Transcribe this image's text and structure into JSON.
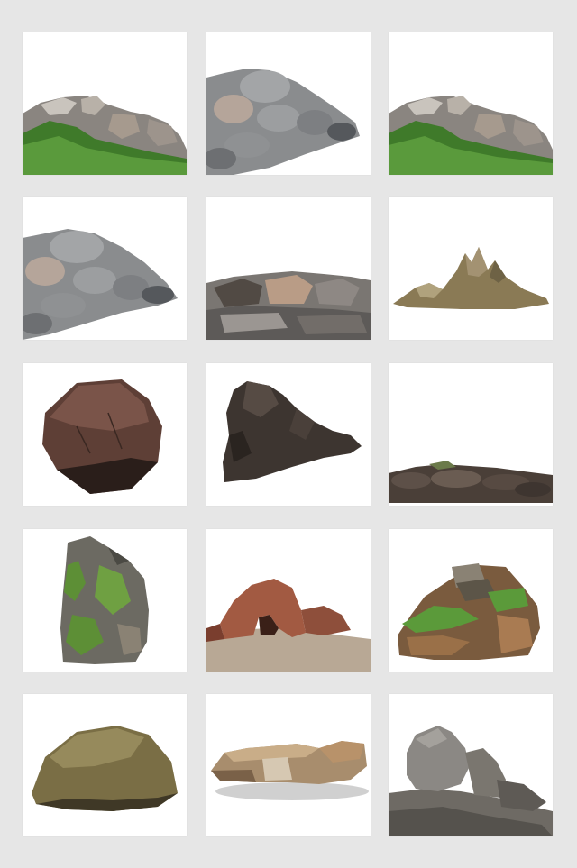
{
  "gallery": {
    "background": "#e6e6e6",
    "tile_background": "#ffffff",
    "items": [
      {
        "name": "rock-pile-with-grass"
      },
      {
        "name": "gray-boulder-pile"
      },
      {
        "name": "rock-pile-with-grass"
      },
      {
        "name": "gray-boulder-pile"
      },
      {
        "name": "flat-rock-row"
      },
      {
        "name": "mountain-peaks-rock"
      },
      {
        "name": "brown-boulder"
      },
      {
        "name": "dark-cliff-rock"
      },
      {
        "name": "low-rock-ledge"
      },
      {
        "name": "mossy-rock-pillar"
      },
      {
        "name": "red-rock-arch"
      },
      {
        "name": "grassy-rock-outcrop"
      },
      {
        "name": "smooth-olive-boulder"
      },
      {
        "name": "layered-stone-slabs"
      },
      {
        "name": "sphinx-rock-formation"
      }
    ]
  }
}
